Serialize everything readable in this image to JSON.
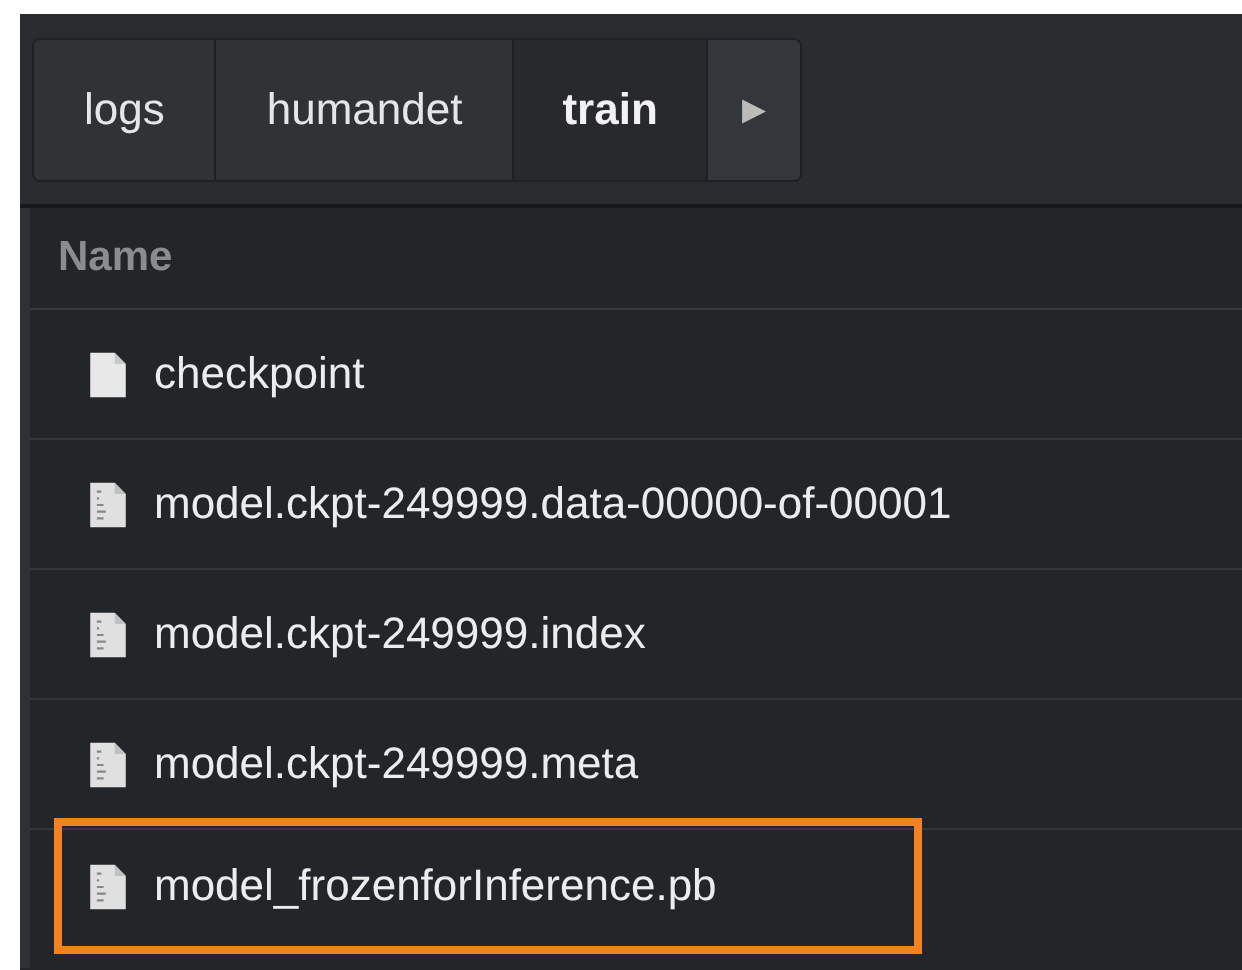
{
  "breadcrumbs": [
    {
      "label": "logs",
      "selected": false
    },
    {
      "label": "humandet",
      "selected": false
    },
    {
      "label": "train",
      "selected": true
    }
  ],
  "breadcrumb_more": "▸",
  "list": {
    "columns": [
      "Name"
    ],
    "rows": [
      {
        "name": "checkpoint",
        "kind": "plain",
        "highlighted": false
      },
      {
        "name": "model.ckpt-249999.data-00000-of-00001",
        "kind": "binary",
        "highlighted": false
      },
      {
        "name": "model.ckpt-249999.index",
        "kind": "binary",
        "highlighted": false
      },
      {
        "name": "model.ckpt-249999.meta",
        "kind": "binary",
        "highlighted": false
      },
      {
        "name": "model_frozenforInference.pb",
        "kind": "binary",
        "highlighted": true
      }
    ]
  }
}
